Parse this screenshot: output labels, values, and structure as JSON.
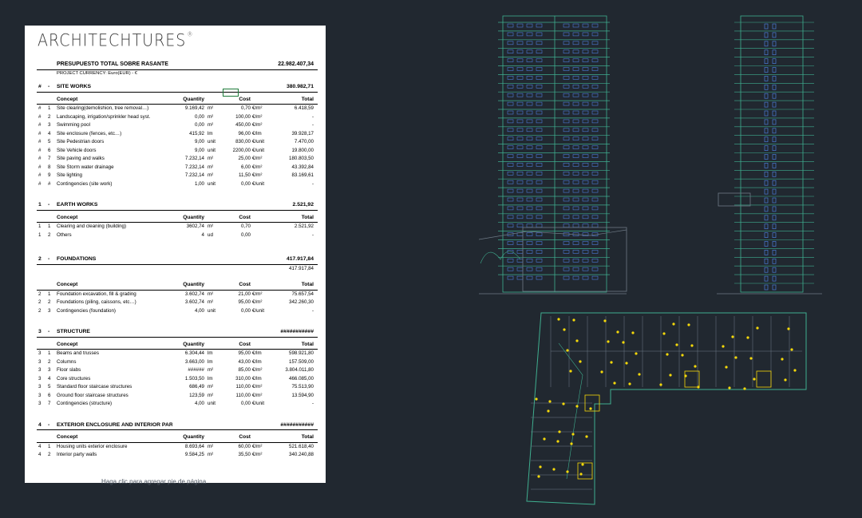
{
  "logo": {
    "text": "ARCHITECHTURES",
    "mark": "®"
  },
  "budget": {
    "title": "PRESUPUESTO TOTAL SOBRE RASANTE",
    "total": "22.982.407,34",
    "currency": "PROJECT CURRENCY: Euro(EUR) - €",
    "col_headers": {
      "concept": "Concept",
      "quantity": "Quantity",
      "cost": "Cost",
      "total": "Total"
    },
    "sections": [
      {
        "num": "#",
        "dash": "-",
        "name": "SITE WORKS",
        "total": "380.982,71",
        "total2": "",
        "rows": [
          [
            "#",
            "1",
            "Site clearing(demolishion, tree removal…)",
            "9.169,42",
            "m²",
            "0,70",
            "€/m²",
            "6.418,59"
          ],
          [
            "#",
            "2",
            "Landscaping, irrigation/sprinkler head syst.",
            "0,00",
            "m²",
            "100,00",
            "€/m²",
            "-"
          ],
          [
            "#",
            "3",
            "Swimming pool",
            "0,00",
            "m²",
            "450,00",
            "€/m²",
            "-"
          ],
          [
            "#",
            "4",
            "Site enclosure (fences, etc…)",
            "415,92",
            "lm",
            "96,00",
            "€/lm",
            "39.928,17"
          ],
          [
            "#",
            "5",
            "Site Pedestrian doors",
            "9,00",
            "unit",
            "830,00",
            "€/unit",
            "7.470,00"
          ],
          [
            "#",
            "6",
            "Site Vehicle doors",
            "9,00",
            "unit",
            "2200,00",
            "€/unit",
            "19.800,00"
          ],
          [
            "#",
            "7",
            "Site paving and walks",
            "7.232,14",
            "m²",
            "25,00",
            "€/m²",
            "180.803,50"
          ],
          [
            "#",
            "8",
            "Site Storm water drainage",
            "7.232,14",
            "m²",
            "6,00",
            "€/m²",
            "43.392,84"
          ],
          [
            "#",
            "9",
            "Site lighting",
            "7.232,14",
            "m²",
            "11,50",
            "€/m²",
            "83.169,61"
          ],
          [
            "#",
            "#",
            "Contingencies (site work)",
            "1,00",
            "unit",
            "0,00",
            "€/unit",
            "-"
          ]
        ]
      },
      {
        "num": "1",
        "dash": "-",
        "name": "EARTH WORKS",
        "total": "2.521,92",
        "total2": "",
        "rows": [
          [
            "1",
            "1",
            "Clearing and cleaning (building)",
            "3602,74",
            "m²",
            "0,70",
            "",
            "2.521,92"
          ],
          [
            "1",
            "2",
            "Others",
            "4",
            "ud",
            "0,00",
            "",
            "-"
          ]
        ]
      },
      {
        "num": "2",
        "dash": "-",
        "name": "FOUNDATIONS",
        "total": "417.917,84",
        "total2": "417.917,84",
        "rows": [
          [
            "2",
            "1",
            "Foundation excavation, fill & grading",
            "3.602,74",
            "m²",
            "21,00",
            "€/m²",
            "75.657,54"
          ],
          [
            "2",
            "2",
            "Foundations (piling, caissons, etc…)",
            "3.602,74",
            "m²",
            "95,00",
            "€/m²",
            "342.260,30"
          ],
          [
            "2",
            "3",
            "Contingencies (foundation)",
            "4,00",
            "unit",
            "0,00",
            "€/unit",
            "-"
          ]
        ]
      },
      {
        "num": "3",
        "dash": "-",
        "name": "STRUCTURE",
        "total": "###########",
        "total2": "",
        "rows": [
          [
            "3",
            "1",
            "Beams and trusses",
            "6.304,44",
            "lm",
            "95,00",
            "€/lm",
            "598.921,80"
          ],
          [
            "3",
            "2",
            "Columns",
            "3.663,00",
            "lm",
            "43,00",
            "€/lm",
            "157.509,00"
          ],
          [
            "3",
            "3",
            "Floor slabs",
            "######",
            "m²",
            "85,00",
            "€/m²",
            "3.804.011,80"
          ],
          [
            "3",
            "4",
            "Core structures",
            "1.503,50",
            "lm",
            "310,00",
            "€/lm",
            "466.085,00"
          ],
          [
            "3",
            "5",
            "Standard floor staircase structures",
            "686,49",
            "m²",
            "110,00",
            "€/m²",
            "75.513,90"
          ],
          [
            "3",
            "6",
            "Ground floor staircase structures",
            "123,59",
            "m²",
            "110,00",
            "€/m²",
            "13.594,90"
          ],
          [
            "3",
            "7",
            "Contingencies (structure)",
            "4,00",
            "unit",
            "0,00",
            "€/unit",
            "-"
          ]
        ]
      },
      {
        "num": "4",
        "dash": "-",
        "name": "EXTERIOR ENCLOSURE AND INTERIOR PARTITIONS",
        "total": "###########",
        "total2": "",
        "rows": [
          [
            "4",
            "1",
            "Housing units exterior enclosure",
            "8.693,64",
            "m²",
            "60,00",
            "€/m²",
            "521.618,40"
          ],
          [
            "4",
            "2",
            "Interior party walls",
            "9.584,25",
            "m²",
            "35,50",
            "€/m²",
            "340.240,88"
          ]
        ]
      }
    ]
  },
  "footer_note": "Haga clic para agregar pie de página",
  "colors": {
    "bg": "#212830",
    "cad_line": "#3fae8f",
    "cad_grid": "#6e7a86",
    "cad_accent": "#f5d90a",
    "cad_blue": "#4b7bd8"
  }
}
